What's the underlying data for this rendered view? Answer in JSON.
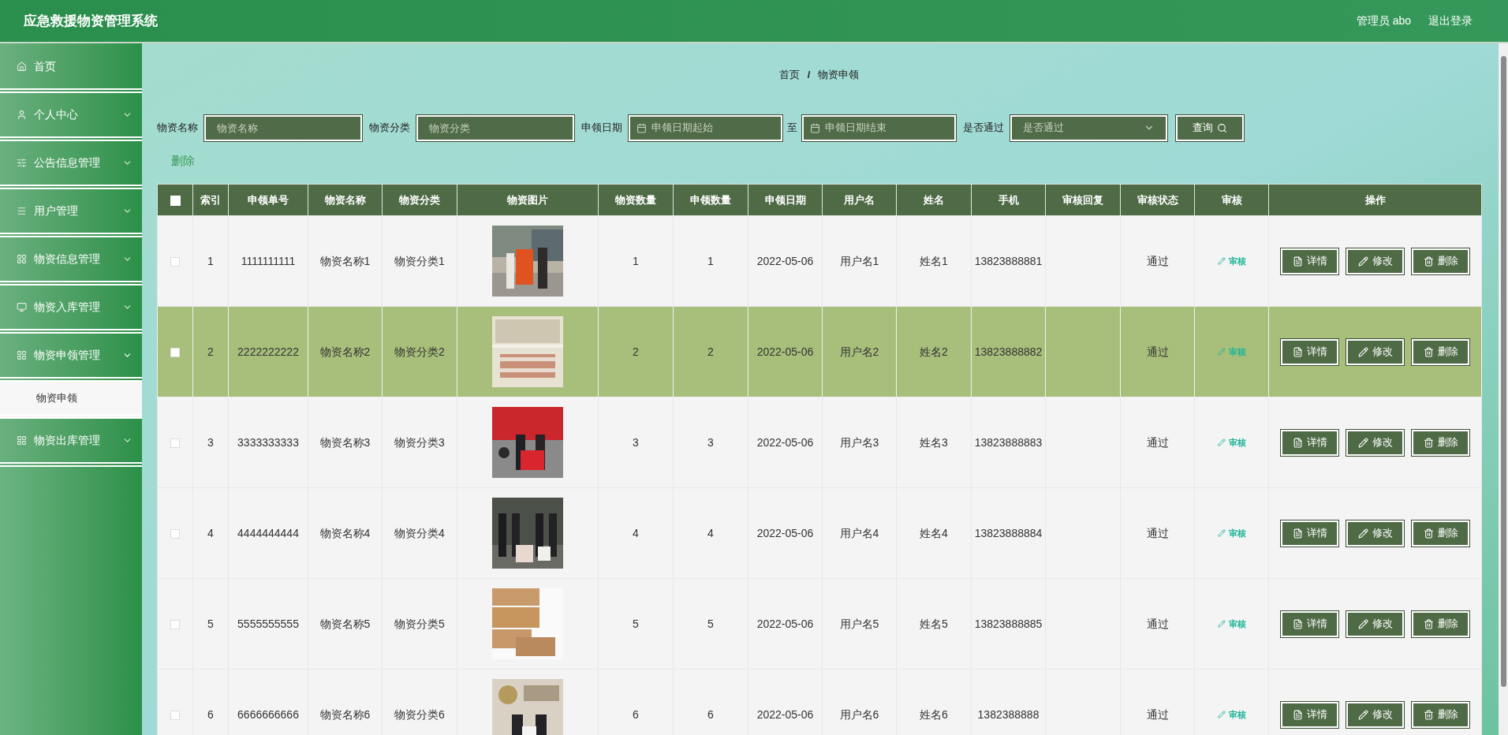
{
  "header": {
    "title": "应急救援物资管理系统",
    "user": "管理员 abo",
    "logout": "退出登录"
  },
  "sidebar": {
    "items": [
      {
        "label": "首页",
        "kind": "link"
      },
      {
        "label": "个人中心",
        "kind": "menu",
        "expanded": false
      },
      {
        "label": "公告信息管理",
        "kind": "menu",
        "expanded": false
      },
      {
        "label": "用户管理",
        "kind": "menu",
        "expanded": false
      },
      {
        "label": "物资信息管理",
        "kind": "menu",
        "expanded": false
      },
      {
        "label": "物资入库管理",
        "kind": "menu",
        "expanded": false
      },
      {
        "label": "物资申领管理",
        "kind": "menu",
        "expanded": true,
        "children": [
          {
            "label": "物资申领"
          }
        ]
      },
      {
        "label": "物资出库管理",
        "kind": "menu",
        "expanded": false
      }
    ]
  },
  "breadcrumb": {
    "items": [
      "首页",
      "物资申领"
    ],
    "separator": "/"
  },
  "search": {
    "fields": [
      {
        "kind": "text",
        "label": "物资名称",
        "placeholder": "物资名称"
      },
      {
        "kind": "text",
        "label": "物资分类",
        "placeholder": "物资分类"
      },
      {
        "kind": "date_range",
        "label": "申领日期",
        "start_placeholder": "申领日期起始",
        "separator": "至",
        "end_placeholder": "申领日期结束"
      },
      {
        "kind": "select",
        "label": "是否通过",
        "placeholder": "是否通过"
      }
    ],
    "button": "查询"
  },
  "toolbar": {
    "delete": "删除"
  },
  "table": {
    "header_checked": false,
    "columns": [
      "索引",
      "申领单号",
      "物资名称",
      "物资分类",
      "物资图片",
      "物资数量",
      "申领数量",
      "申领日期",
      "用户名",
      "姓名",
      "手机",
      "审核回复",
      "审核状态",
      "审核",
      "操作"
    ],
    "rows": [
      {
        "selected": false,
        "checked": false,
        "index": "1",
        "number": "1111111111",
        "name": "物资名称1",
        "category": "物资分类1",
        "quantity": "1",
        "applied": "1",
        "date": "2022-05-06",
        "username": "用户名1",
        "realname": "姓名1",
        "phone": "13823888881",
        "status": "通过",
        "audit": "审核",
        "actions": [
          "详情",
          "修改",
          "删除"
        ]
      },
      {
        "selected": true,
        "checked": false,
        "index": "2",
        "number": "2222222222",
        "name": "物资名称2",
        "category": "物资分类2",
        "quantity": "2",
        "applied": "2",
        "date": "2022-05-06",
        "username": "用户名2",
        "realname": "姓名2",
        "phone": "13823888882",
        "status": "通过",
        "audit": "审核",
        "actions": [
          "详情",
          "修改",
          "删除"
        ]
      },
      {
        "selected": false,
        "checked": false,
        "index": "3",
        "number": "3333333333",
        "name": "物资名称3",
        "category": "物资分类3",
        "quantity": "3",
        "applied": "3",
        "date": "2022-05-06",
        "username": "用户名3",
        "realname": "姓名3",
        "phone": "13823888883",
        "status": "通过",
        "audit": "审核",
        "actions": [
          "详情",
          "修改",
          "删除"
        ]
      },
      {
        "selected": false,
        "checked": false,
        "index": "4",
        "number": "4444444444",
        "name": "物资名称4",
        "category": "物资分类4",
        "quantity": "4",
        "applied": "4",
        "date": "2022-05-06",
        "username": "用户名4",
        "realname": "姓名4",
        "phone": "13823888884",
        "status": "通过",
        "audit": "审核",
        "actions": [
          "详情",
          "修改",
          "删除"
        ]
      },
      {
        "selected": false,
        "checked": false,
        "index": "5",
        "number": "5555555555",
        "name": "物资名称5",
        "category": "物资分类5",
        "quantity": "5",
        "applied": "5",
        "date": "2022-05-06",
        "username": "用户名5",
        "realname": "姓名5",
        "phone": "13823888885",
        "status": "通过",
        "audit": "审核",
        "actions": [
          "详情",
          "修改",
          "删除"
        ]
      },
      {
        "selected": false,
        "checked": false,
        "index": "6",
        "number": "6666666666",
        "name": "物资名称6",
        "category": "物资分类6",
        "quantity": "6",
        "applied": "6",
        "date": "2022-05-06",
        "username": "用户名6",
        "realname": "姓名6",
        "phone": "1382388888",
        "status": "通过",
        "audit": "审核",
        "actions": [
          "详情",
          "修改",
          "删除"
        ]
      }
    ]
  }
}
